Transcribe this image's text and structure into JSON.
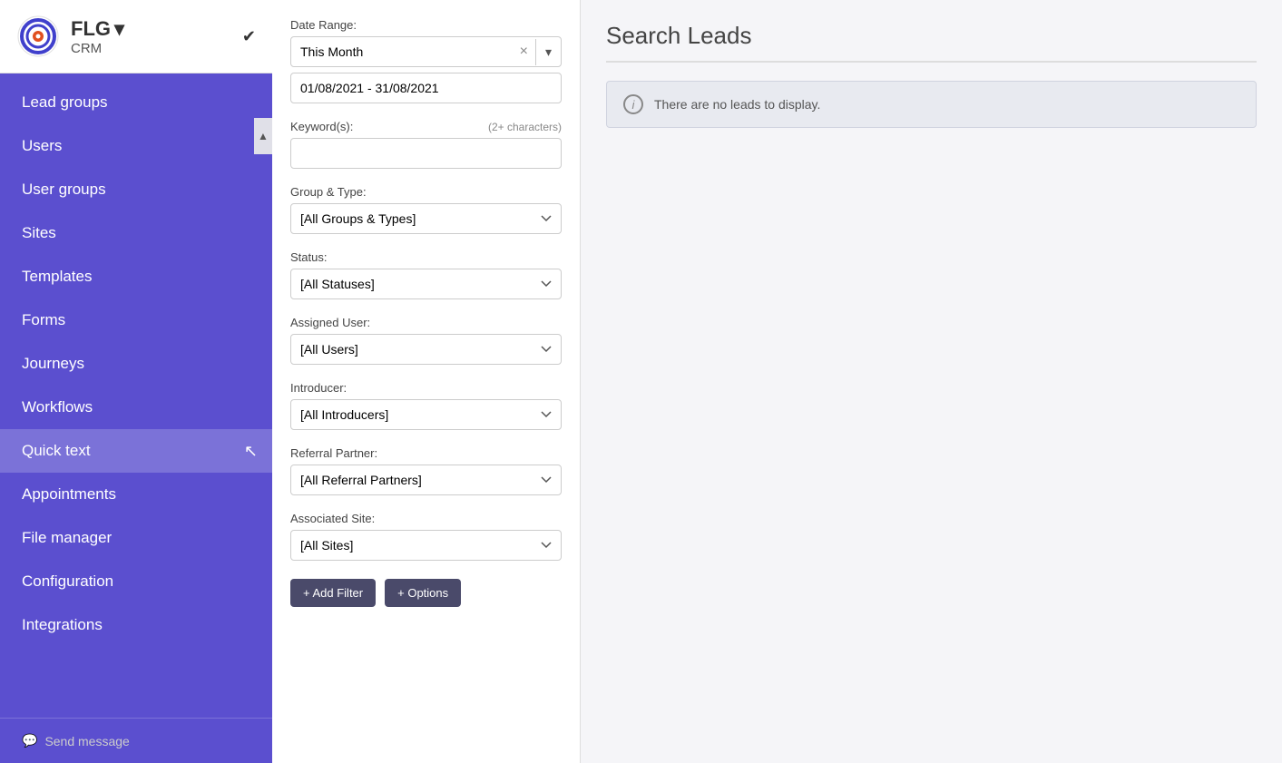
{
  "app": {
    "name": "FLG",
    "subtitle": "CRM",
    "dropdown_icon": "▾",
    "check_icon": "✔"
  },
  "sidebar": {
    "items": [
      {
        "id": "lead-groups",
        "label": "Lead groups"
      },
      {
        "id": "users",
        "label": "Users"
      },
      {
        "id": "user-groups",
        "label": "User groups"
      },
      {
        "id": "sites",
        "label": "Sites"
      },
      {
        "id": "templates",
        "label": "Templates"
      },
      {
        "id": "forms",
        "label": "Forms"
      },
      {
        "id": "journeys",
        "label": "Journeys"
      },
      {
        "id": "workflows",
        "label": "Workflows"
      },
      {
        "id": "quick-text",
        "label": "Quick text"
      },
      {
        "id": "appointments",
        "label": "Appointments"
      },
      {
        "id": "file-manager",
        "label": "File manager"
      },
      {
        "id": "configuration",
        "label": "Configuration"
      },
      {
        "id": "integrations",
        "label": "Integrations"
      }
    ],
    "bottom": {
      "icon": "💬",
      "label": "Send message"
    }
  },
  "filter": {
    "date_range_label": "Date Range:",
    "date_range_value": "This Month",
    "date_range_clear": "×",
    "date_range_dropdown": "▾",
    "date_range_text": "01/08/2021 - 31/08/2021",
    "keywords_label": "Keyword(s):",
    "keywords_hint": "(2+ characters)",
    "keywords_placeholder": "",
    "group_type_label": "Group & Type:",
    "group_type_options": [
      "[All Groups & Types]"
    ],
    "group_type_value": "[All Groups & Types]",
    "status_label": "Status:",
    "status_options": [
      "[All Statuses]"
    ],
    "status_value": "[All Statuses]",
    "assigned_user_label": "Assigned User:",
    "assigned_user_options": [
      "[All Users]"
    ],
    "assigned_user_value": "[All Users]",
    "introducer_label": "Introducer:",
    "introducer_options": [
      "[All Introducers]"
    ],
    "introducer_value": "[All Introducers]",
    "referral_partner_label": "Referral Partner:",
    "referral_partner_options": [
      "[All Referral Partners]"
    ],
    "referral_partner_value": "[All Referral Partners]",
    "associated_site_label": "Associated Site:",
    "associated_site_options": [
      "[All Sites]"
    ],
    "associated_site_value": "[All Sites]",
    "add_filter_label": "+ Add Filter",
    "options_label": "+ Options"
  },
  "content": {
    "title": "Search Leads",
    "no_results_message": "There are no leads to display.",
    "info_icon": "i"
  }
}
